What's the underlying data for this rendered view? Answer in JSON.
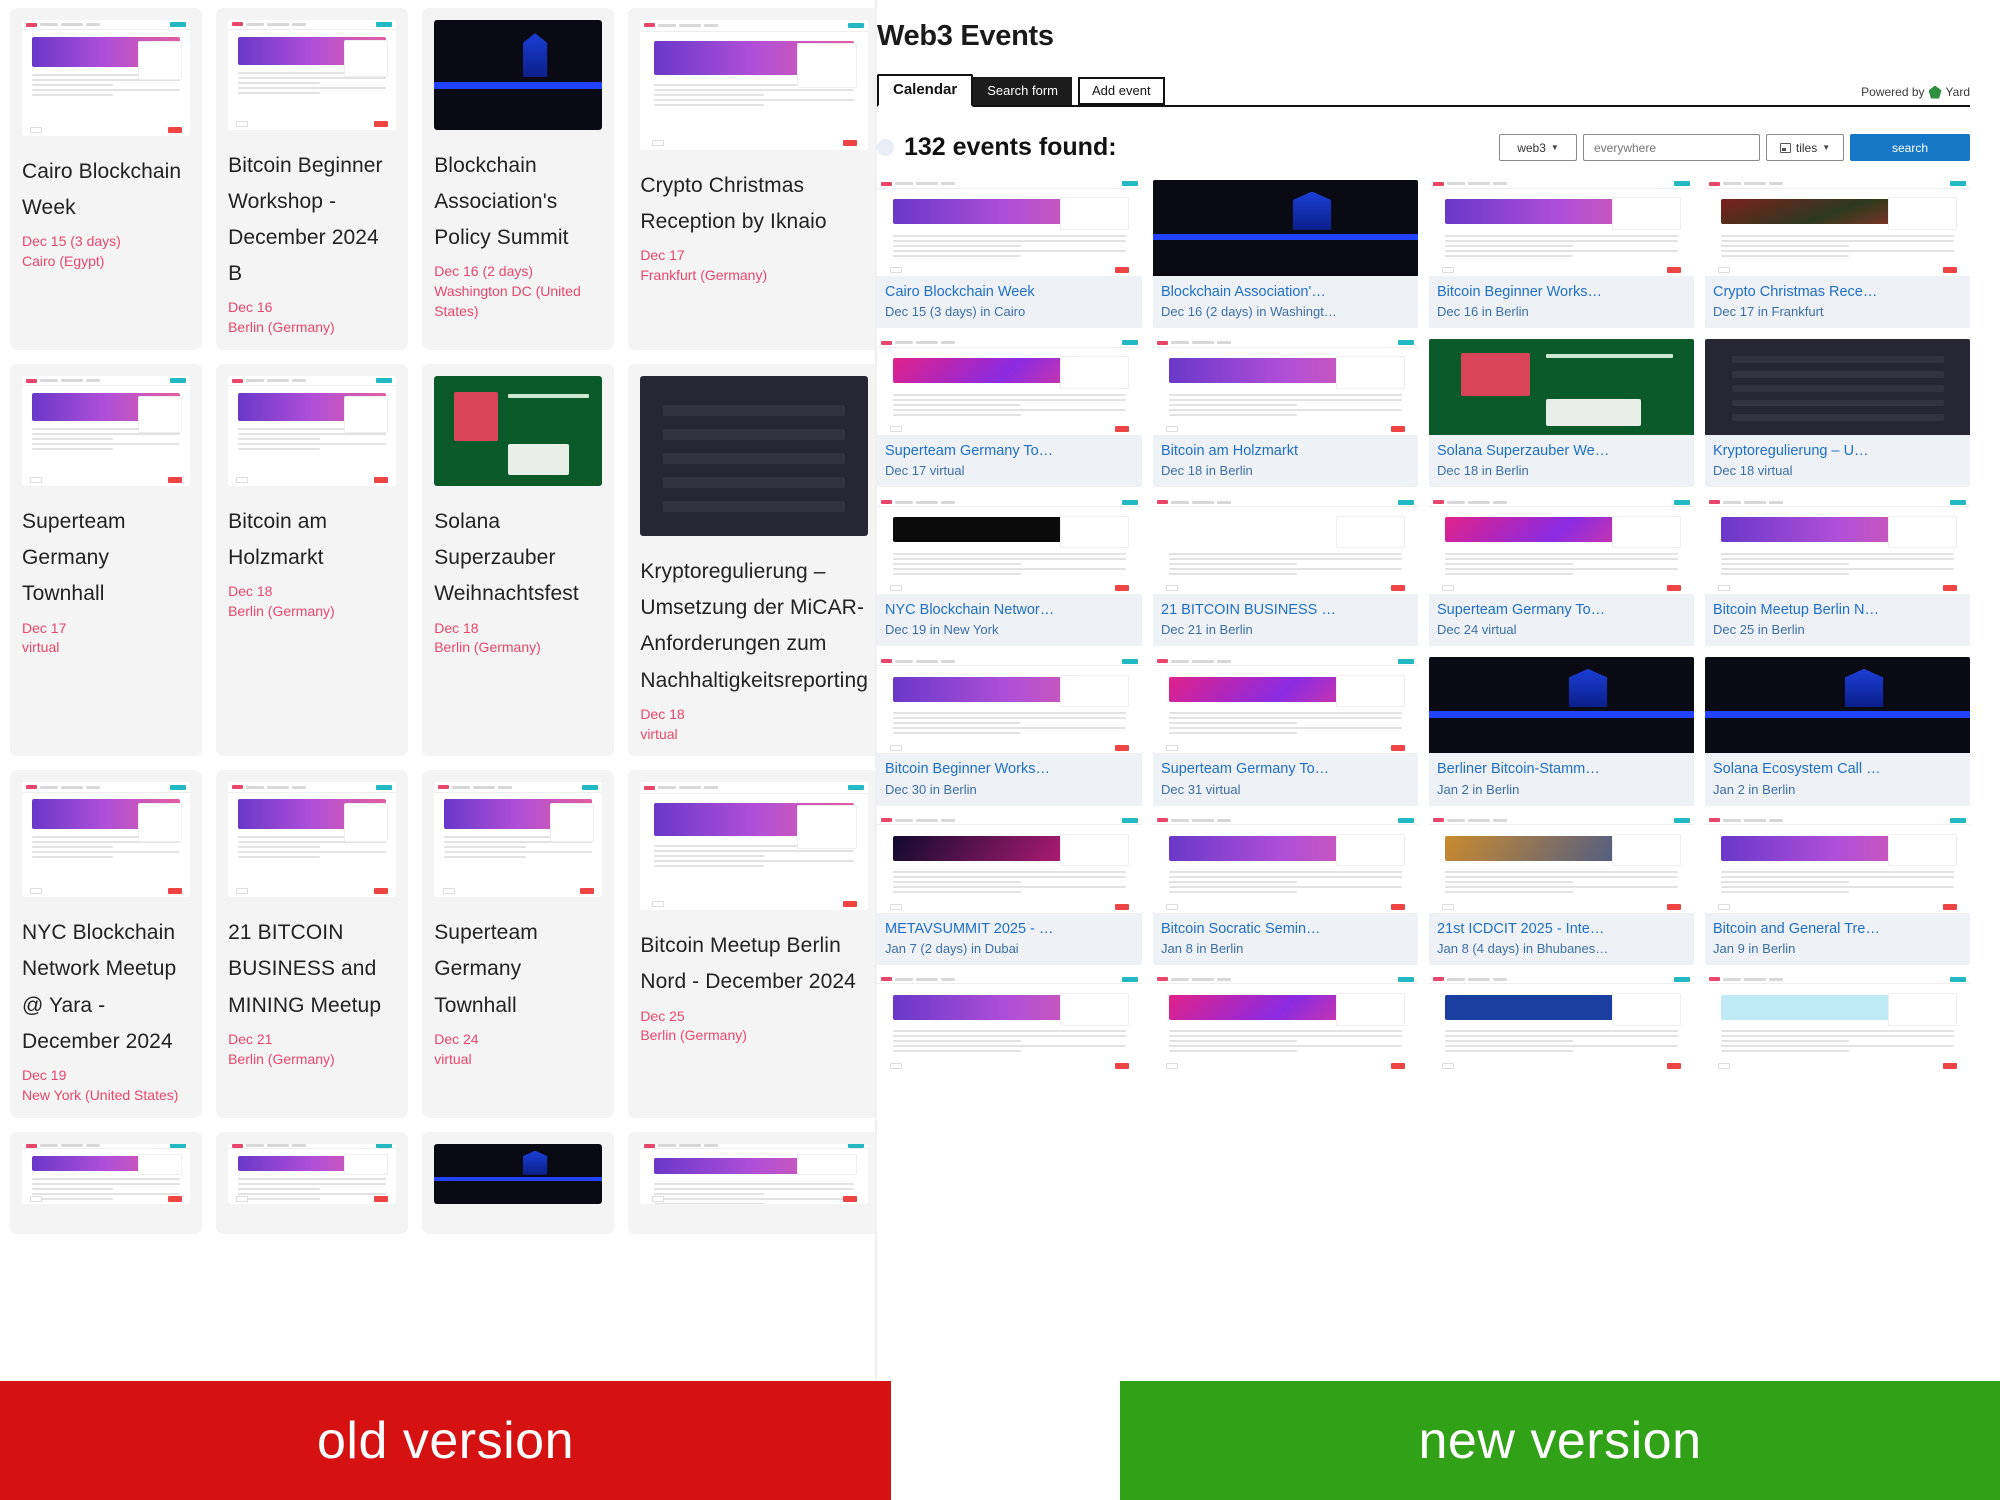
{
  "banners": {
    "old_label": "old version",
    "new_label": "new version",
    "old_color": "#d51111",
    "new_color": "#31a218"
  },
  "old_version": {
    "cards": [
      {
        "title": "Cairo Blockchain Week",
        "date": "Dec 15 (3 days)",
        "location": "Cairo (Egypt)",
        "thumb": "light"
      },
      {
        "title": "Bitcoin Beginner Workshop - December 2024 B",
        "date": "Dec 16",
        "location": "Berlin (Germany)",
        "thumb": "light"
      },
      {
        "title": "Blockchain Association's Policy Summit",
        "date": "Dec 16 (2 days)",
        "location": "Washington DC (United States)",
        "thumb": "dark"
      },
      {
        "title": "Crypto Christmas Reception by Iknaio",
        "date": "Dec 17",
        "location": "Frankfurt (Germany)",
        "thumb": "light"
      },
      {
        "title": "Superteam Germany Townhall",
        "date": "Dec 17",
        "location": "virtual",
        "thumb": "light"
      },
      {
        "title": "Bitcoin am Holzmarkt",
        "date": "Dec 18",
        "location": "Berlin (Germany)",
        "thumb": "light"
      },
      {
        "title": "Solana Superzauber Weihnachtsfest",
        "date": "Dec 18",
        "location": "Berlin (Germany)",
        "thumb": "green"
      },
      {
        "title": "Kryptoregulierung – Umsetzung der MiCAR-Anforderungen zum Nachhaltigkeitsreporting",
        "date": "Dec 18",
        "location": "virtual",
        "thumb": "navy"
      },
      {
        "title": "NYC Blockchain Network Meetup @ Yara - December 2024",
        "date": "Dec 19",
        "location": "New York (United States)",
        "thumb": "light"
      },
      {
        "title": "21 BITCOIN BUSINESS and MINING Meetup",
        "date": "Dec 21",
        "location": "Berlin (Germany)",
        "thumb": "light"
      },
      {
        "title": "Superteam Germany Townhall",
        "date": "Dec 24",
        "location": "virtual",
        "thumb": "light"
      },
      {
        "title": "Bitcoin Meetup Berlin Nord - December 2024",
        "date": "Dec 25",
        "location": "Berlin (Germany)",
        "thumb": "light"
      },
      {
        "title": "",
        "date": "",
        "location": "",
        "thumb": "light"
      },
      {
        "title": "",
        "date": "",
        "location": "",
        "thumb": "light"
      },
      {
        "title": "",
        "date": "",
        "location": "",
        "thumb": "dark"
      },
      {
        "title": "",
        "date": "",
        "location": "",
        "thumb": "light"
      }
    ]
  },
  "new_version": {
    "header": {
      "title": "Web3 Events"
    },
    "tabs": [
      {
        "label": "Calendar",
        "style": "active"
      },
      {
        "label": "Search form",
        "style": "dark"
      },
      {
        "label": "Add event",
        "style": "plain"
      }
    ],
    "powered_by": {
      "text": "Powered by",
      "brand": "Yard"
    },
    "results": {
      "count_label": "132 events found:"
    },
    "controls": {
      "keyword": "web3",
      "place_placeholder": "everywhere",
      "view": "tiles",
      "search_label": "search"
    },
    "cards": [
      {
        "title": "Cairo Blockchain Week",
        "meta": "Dec 15 (3 days) in Cairo",
        "thumb": "light"
      },
      {
        "title": "Blockchain Association'…",
        "meta": "Dec 16 (2 days) in Washingt…",
        "thumb": "dark"
      },
      {
        "title": "Bitcoin Beginner Works…",
        "meta": "Dec 16 in Berlin",
        "thumb": "light"
      },
      {
        "title": "Crypto Christmas Rece…",
        "meta": "Dec 17 in Frankfurt",
        "thumb": "xmas"
      },
      {
        "title": "Superteam Germany To…",
        "meta": "Dec 17 virtual",
        "thumb": "pink"
      },
      {
        "title": "Bitcoin am Holzmarkt",
        "meta": "Dec 18 in Berlin",
        "thumb": "light"
      },
      {
        "title": "Solana Superzauber We…",
        "meta": "Dec 18 in Berlin",
        "thumb": "green"
      },
      {
        "title": "Kryptoregulierung – U…",
        "meta": "Dec 18 virtual",
        "thumb": "navy"
      },
      {
        "title": "NYC Blockchain Networ…",
        "meta": "Dec 19 in New York",
        "thumb": "nyc"
      },
      {
        "title": "21 BITCOIN BUSINESS …",
        "meta": "Dec 21 in Berlin",
        "thumb": "21"
      },
      {
        "title": "Superteam Germany To…",
        "meta": "Dec 24 virtual",
        "thumb": "pink"
      },
      {
        "title": "Bitcoin Meetup Berlin N…",
        "meta": "Dec 25 in Berlin",
        "thumb": "light"
      },
      {
        "title": "Bitcoin Beginner Works…",
        "meta": "Dec 30 in Berlin",
        "thumb": "light"
      },
      {
        "title": "Superteam Germany To…",
        "meta": "Dec 31 virtual",
        "thumb": "pink"
      },
      {
        "title": "Berliner Bitcoin-Stamm…",
        "meta": "Jan 2 in Berlin",
        "thumb": "dark"
      },
      {
        "title": "Solana Ecosystem Call …",
        "meta": "Jan 2 in Berlin",
        "thumb": "black"
      },
      {
        "title": "METAVSUMMIT 2025 - …",
        "meta": "Jan 7 (2 days) in Dubai",
        "thumb": "metav"
      },
      {
        "title": "Bitcoin Socratic Semin…",
        "meta": "Jan 8 in Berlin",
        "thumb": "light"
      },
      {
        "title": "21st ICDCIT 2025 - Inte…",
        "meta": "Jan 8 (4 days) in Bhubanes…",
        "thumb": "icdcit"
      },
      {
        "title": "Bitcoin and General Tre…",
        "meta": "Jan 9 in Berlin",
        "thumb": "light"
      },
      {
        "title": "",
        "meta": "",
        "thumb": "light"
      },
      {
        "title": "",
        "meta": "",
        "thumb": "pink"
      },
      {
        "title": "",
        "meta": "",
        "thumb": "blue"
      },
      {
        "title": "",
        "meta": "",
        "thumb": "cyan"
      }
    ]
  }
}
